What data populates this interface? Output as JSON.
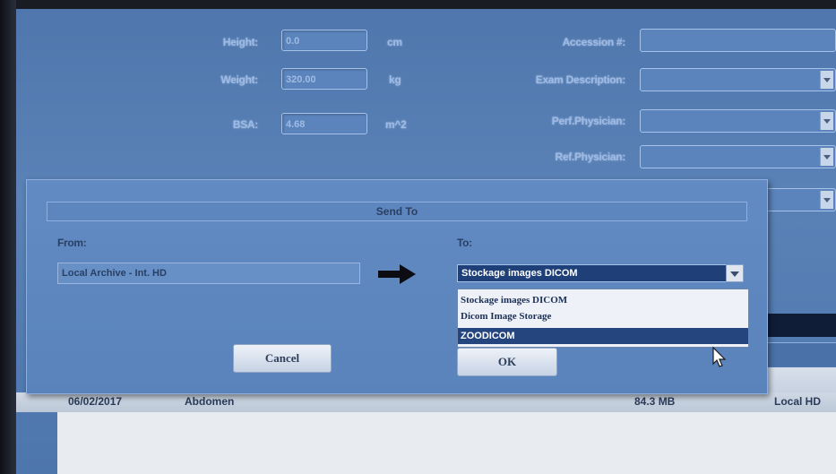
{
  "patient_form": {
    "height_label": "Height:",
    "height_value": "0.0",
    "height_unit": "cm",
    "weight_label": "Weight:",
    "weight_value": "320.00",
    "weight_unit": "kg",
    "bsa_label": "BSA:",
    "bsa_value": "4.68",
    "bsa_unit": "m^2",
    "accession_label": "Accession #:",
    "exam_description_label": "Exam Description:",
    "perf_physician_label": "Perf.Physician:",
    "ref_physician_label": "Ref.Physician:"
  },
  "dialog": {
    "title": "Send To",
    "from_label": "From:",
    "from_value": "Local Archive - Int. HD",
    "to_label": "To:",
    "to_selected": "Stockage images DICOM",
    "to_options": [
      "Stockage images DICOM",
      "Dicom Image Storage",
      "ZOODICOM"
    ],
    "highlighted_option_index": 2,
    "cancel_label": "Cancel",
    "ok_label": "OK"
  },
  "exam_list": {
    "row": {
      "date": "06/02/2017",
      "exam": "Abdomen",
      "size": "84.3 MB",
      "location": "Local HD"
    }
  },
  "colors": {
    "background_blue": "#5a82b7",
    "selection_navy": "#25457f"
  }
}
